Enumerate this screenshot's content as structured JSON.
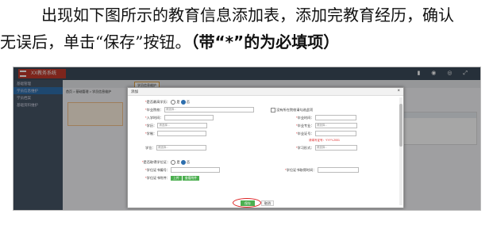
{
  "paragraph": {
    "line1": "出现如下图所示的教育信息添加表，添加完教育经历，确认",
    "line2_prefix": "无误后，单击“保存”按钮。",
    "line2_emphasis": "（带“*”的为必填项）"
  },
  "screenshot": {
    "app_logo": "XX教务系统",
    "sidebar": {
      "items": [
        "基础管理",
        "学员信息维护",
        "学员档案",
        "基础资料维护"
      ]
    },
    "tab_label": "学员信息维护",
    "breadcrumb": "首页 > 基础管理 > 学员信息维护",
    "dialog": {
      "title": "添加",
      "close_glyph": "×",
      "is_top_degree_label": "是否最高学历：",
      "yes": "是",
      "no": "否",
      "institution_label": "毕业院校：",
      "institution_placeholder": "请选择...",
      "unlisted_label": "没有所在院校请勾选此项",
      "entry_time_label": "入学时间：",
      "graduation_time_label": "毕业时间：",
      "education_label": "学历：",
      "education_placeholder": "请选择...",
      "major_label": "毕业专业：",
      "major_placeholder": "请选择...",
      "degree_label": "学制：",
      "cert_no_label": "毕业证号：",
      "cert_hint": "请填写证号：YYYY-2001",
      "degree_type_label": "学位：",
      "degree_type_placeholder": "请选择...",
      "study_form_label": "学习形式：",
      "study_form_placeholder": "请选择...",
      "has_degree_label": "是否取得学位证：",
      "degree_cert_no_label": "学位证书编号：",
      "degree_cert_date_label": "学位证书取得时间：",
      "upload_label": "学位证书附件：",
      "upload_btn": "上传",
      "view_btn": "查看附件",
      "save_btn": "保存",
      "cancel_btn": "取消"
    }
  }
}
